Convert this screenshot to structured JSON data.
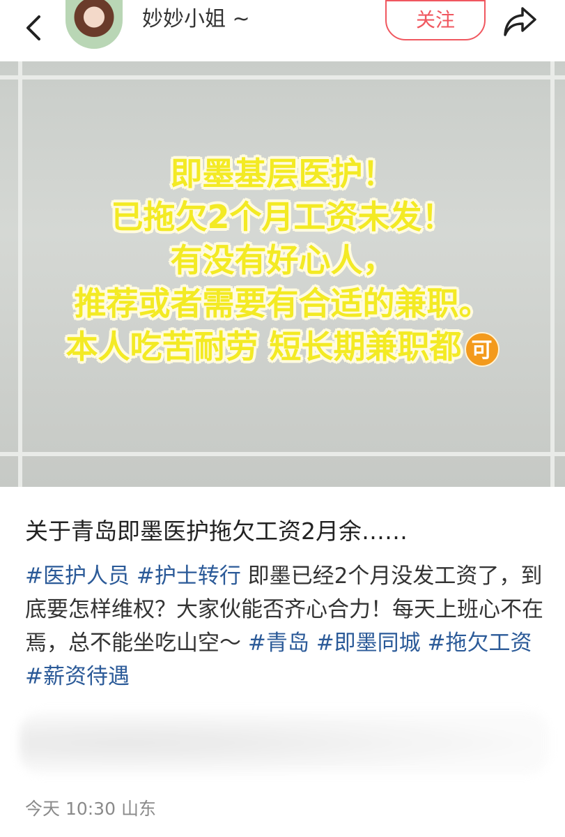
{
  "header": {
    "username": "妙妙小姐 ~",
    "follow_label": "关注"
  },
  "image": {
    "overlay_lines": [
      "即墨基层医护！",
      "已拖欠2个月工资未发！",
      "有没有好心人，",
      "推荐或者需要有合适的兼职。",
      "本人吃苦耐劳  短长期兼职都"
    ],
    "overlay_badge": "可",
    "text_color": "#f3ea24"
  },
  "post": {
    "title": "关于青岛即墨医护拖欠工资2月余……",
    "body_parts": [
      {
        "type": "tag",
        "text": "#医护人员"
      },
      {
        "type": "text",
        "text": " "
      },
      {
        "type": "tag",
        "text": "#护士转行"
      },
      {
        "type": "text",
        "text": " 即墨已经2个月没发工资了，到底要怎样维权？大家伙能否齐心合力！每天上班心不在焉，总不能坐吃山空～ "
      },
      {
        "type": "tag",
        "text": "#青岛"
      },
      {
        "type": "text",
        "text": " "
      },
      {
        "type": "tag",
        "text": "#即墨同城"
      },
      {
        "type": "text",
        "text": " "
      },
      {
        "type": "tag",
        "text": "#拖欠工资"
      },
      {
        "type": "text",
        "text": " "
      },
      {
        "type": "tag",
        "text": "#薪资待遇"
      }
    ],
    "meta": "今天 10:30 山东",
    "accent_color": "#f0575f",
    "tag_color": "#2b5a98"
  }
}
